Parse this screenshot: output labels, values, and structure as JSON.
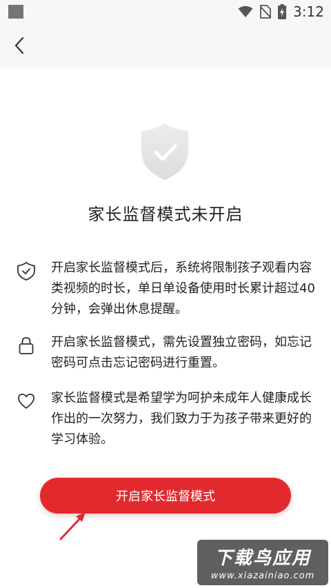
{
  "status_bar": {
    "time": "3:12",
    "icons": [
      "square-notification-icon",
      "wifi-icon",
      "no-sim-icon",
      "battery-charging-icon"
    ]
  },
  "top_bar": {
    "back_icon": "chevron-left-icon"
  },
  "hero": {
    "icon": "shield-check-icon",
    "title": "家长监督模式未开启"
  },
  "info_items": [
    {
      "icon": "shield-check-outline-icon",
      "text": "开启家长监督模式后，系统将限制孩子观看内容类视频的时长，单日单设备使用时长累计超过40分钟，会弹出休息提醒。"
    },
    {
      "icon": "lock-icon",
      "text": "开启家长监督模式，需先设置独立密码，如忘记密码可点击忘记密码进行重置。"
    },
    {
      "icon": "heart-outline-icon",
      "text": "家长监督模式是希望学为呵护未成年人健康成长作出的一次努力，我们致力于为孩子带来更好的学习体验。"
    }
  ],
  "primary_button": {
    "label": "开启家长监督模式"
  },
  "watermark": {
    "title": "下载鸟应用",
    "url": "www.xiazainiao.com"
  },
  "colors": {
    "accent": "#e22a2e",
    "background": "#ffffff",
    "bar_background": "#f7f7f7",
    "shield": "#e6e6e6"
  }
}
